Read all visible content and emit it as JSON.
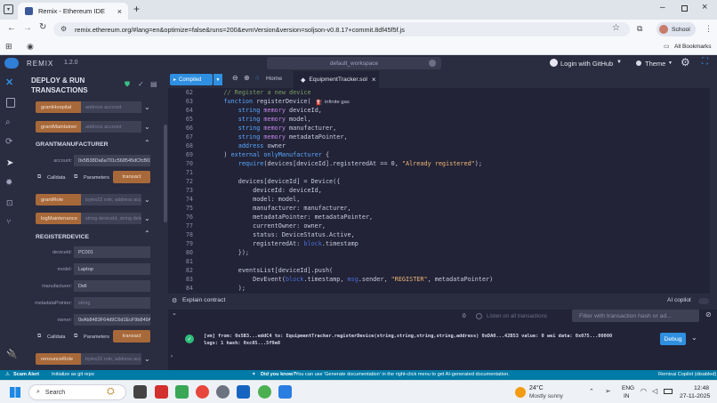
{
  "browser": {
    "tab_title": "Remix - Ethereum IDE",
    "url": "remix.ethereum.org/#lang=en&optimize=false&runs=200&evmVersion&version=soljson-v0.8.17+commit.8df45f5f.js",
    "profile": "School",
    "bookmarks": "All Bookmarks"
  },
  "remix": {
    "logo": "REMIX",
    "version": "1.2.0",
    "workspace": "default_workspace",
    "login": "Login with GitHub",
    "theme": "Theme"
  },
  "panel": {
    "title1": "DEPLOY & RUN",
    "title2": "TRANSACTIONS",
    "fn_rows": [
      {
        "label": "grantHospital",
        "placeholder": "address account"
      },
      {
        "label": "grantMaintainer",
        "placeholder": "address account"
      }
    ],
    "gm": {
      "header": "GRANTMANUFACTURER",
      "account_label": "account:",
      "account_value": "0x5B38Da6a701c568545dCfcB03FcB875f56beddC4",
      "calldata": "Calldata",
      "parameters": "Parameters",
      "transact": "transact"
    },
    "mid_rows": [
      {
        "label": "grantRole",
        "placeholder": "bytes32 role, address account"
      },
      {
        "label": "logMaintenance",
        "placeholder": "string deviceId, string detail"
      }
    ],
    "rd": {
      "header": "REGISTERDEVICE",
      "fields": [
        {
          "label": "deviceId:",
          "value": "PC001"
        },
        {
          "label": "model:",
          "value": "Laptop"
        },
        {
          "label": "manufacturer:",
          "value": "Dell"
        },
        {
          "label": "metadataPointer:",
          "value": "",
          "placeholder": "string"
        },
        {
          "label": "owner:",
          "value": "0xAb8483F64d9C6d1EcF9b849Ae677dD3315835cb2"
        }
      ],
      "calldata": "Calldata",
      "parameters": "Parameters",
      "transact": "transact"
    },
    "last_row": {
      "label": "renounceRole",
      "placeholder": "bytes32 role, address account"
    }
  },
  "editor": {
    "compiled": "Compiled",
    "home": "Home",
    "file": "EquipmentTracker.sol",
    "infinite_gas": "infinite gas",
    "lines": [
      {
        "n": "62",
        "t": "    // Register a new device"
      },
      {
        "n": "63",
        "t": "    function registerDevice("
      },
      {
        "n": "64",
        "t": "        string memory deviceId,"
      },
      {
        "n": "65",
        "t": "        string memory model,"
      },
      {
        "n": "66",
        "t": "        string memory manufacturer,"
      },
      {
        "n": "67",
        "t": "        string memory metadataPointer,"
      },
      {
        "n": "68",
        "t": "        address owner"
      },
      {
        "n": "69",
        "t": "    ) external onlyManufacturer {"
      },
      {
        "n": "70",
        "t": "        require(devices[deviceId].registeredAt == 0, \"Already registered\");"
      },
      {
        "n": "71",
        "t": ""
      },
      {
        "n": "72",
        "t": "        devices[deviceId] = Device({"
      },
      {
        "n": "73",
        "t": "            deviceId: deviceId,"
      },
      {
        "n": "74",
        "t": "            model: model,"
      },
      {
        "n": "75",
        "t": "            manufacturer: manufacturer,"
      },
      {
        "n": "76",
        "t": "            metadataPointer: metadataPointer,"
      },
      {
        "n": "77",
        "t": "            currentOwner: owner,"
      },
      {
        "n": "78",
        "t": "            status: DeviceStatus.Active,"
      },
      {
        "n": "79",
        "t": "            registeredAt: block.timestamp"
      },
      {
        "n": "80",
        "t": "        });"
      },
      {
        "n": "81",
        "t": ""
      },
      {
        "n": "82",
        "t": "        eventsList[deviceId].push("
      },
      {
        "n": "83",
        "t": "            DevEvent(block.timestamp, msg.sender, \"REGISTER\", metadataPointer)"
      },
      {
        "n": "84",
        "t": "        );"
      }
    ]
  },
  "terminal": {
    "explain": "Explain contract",
    "ai": "AI copilot",
    "count": "0",
    "listen": "Listen on all transactions",
    "filter_placeholder": "Filter with transaction hash or ad...",
    "log1": "[vm] from: 0x5B3...eddC4 to: EquipmentTracker.registerDevice(string,string,string,string,address) 0xDA0...42B53 value: 0 wei data: 0x075...00000",
    "log2": "logs: 1 hash: 0xc85...5f9e8",
    "debug": "Debug"
  },
  "statusbar": {
    "scam": "Scam Alert",
    "git": "Initialize as git repo",
    "tip_bold": "Did you know?",
    "tip": "You can use 'Generate documentation' in the right-click menu to get AI-generated documentation.",
    "copilot": "Remixai Copilot (disabled)"
  },
  "taskbar": {
    "search": "Search",
    "temp": "24°C",
    "weather": "Mostly sunny",
    "lang1": "ENG",
    "lang2": "IN",
    "time": "12:48",
    "date": "27-11-2025"
  },
  "colors": {
    "accent": "#007aa6",
    "orange": "#a8693a",
    "compiled": "#2f8fe0"
  }
}
